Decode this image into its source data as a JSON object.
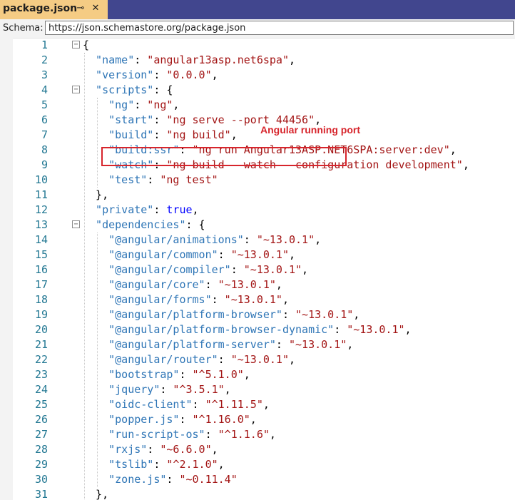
{
  "tab": {
    "title": "package.json",
    "pin_glyph": "⊸",
    "close_glyph": "✕"
  },
  "schema": {
    "label": "Schema:",
    "value": "https://json.schemastore.org/package.json"
  },
  "annotation": {
    "text": "Angular running port",
    "color": "#d7252c"
  },
  "colors": {
    "key": "#2e75b6",
    "string": "#a31515",
    "keyword": "#0000ff",
    "line_number": "#237893",
    "tab_active": "#f5cc84",
    "tab_bar": "#41468e"
  },
  "lines": [
    {
      "n": "1",
      "indent": 0,
      "fold": true,
      "tokens": [
        {
          "t": "p",
          "v": "{"
        }
      ]
    },
    {
      "n": "2",
      "indent": 1,
      "tokens": [
        {
          "t": "k",
          "v": "\"name\""
        },
        {
          "t": "p",
          "v": ": "
        },
        {
          "t": "s",
          "v": "\"angular13asp.net6spa\""
        },
        {
          "t": "p",
          "v": ","
        }
      ]
    },
    {
      "n": "3",
      "indent": 1,
      "tokens": [
        {
          "t": "k",
          "v": "\"version\""
        },
        {
          "t": "p",
          "v": ": "
        },
        {
          "t": "s",
          "v": "\"0.0.0\""
        },
        {
          "t": "p",
          "v": ","
        }
      ]
    },
    {
      "n": "4",
      "indent": 1,
      "fold": true,
      "tokens": [
        {
          "t": "k",
          "v": "\"scripts\""
        },
        {
          "t": "p",
          "v": ": {"
        }
      ]
    },
    {
      "n": "5",
      "indent": 2,
      "tokens": [
        {
          "t": "k",
          "v": "\"ng\""
        },
        {
          "t": "p",
          "v": ": "
        },
        {
          "t": "s",
          "v": "\"ng\""
        },
        {
          "t": "p",
          "v": ","
        }
      ]
    },
    {
      "n": "6",
      "indent": 2,
      "tokens": [
        {
          "t": "k",
          "v": "\"start\""
        },
        {
          "t": "p",
          "v": ": "
        },
        {
          "t": "s",
          "v": "\"ng serve --port 44456\""
        },
        {
          "t": "p",
          "v": ","
        }
      ]
    },
    {
      "n": "7",
      "indent": 2,
      "tokens": [
        {
          "t": "k",
          "v": "\"build\""
        },
        {
          "t": "p",
          "v": ": "
        },
        {
          "t": "s",
          "v": "\"ng build\""
        },
        {
          "t": "p",
          "v": ","
        }
      ]
    },
    {
      "n": "8",
      "indent": 2,
      "tokens": [
        {
          "t": "k",
          "v": "\"build:ssr\""
        },
        {
          "t": "p",
          "v": ": "
        },
        {
          "t": "s",
          "v": "\"ng run Angular13ASP.NET6SPA:server:dev\""
        },
        {
          "t": "p",
          "v": ","
        }
      ]
    },
    {
      "n": "9",
      "indent": 2,
      "tokens": [
        {
          "t": "k",
          "v": "\"watch\""
        },
        {
          "t": "p",
          "v": ": "
        },
        {
          "t": "s",
          "v": "\"ng build --watch --configuration development\""
        },
        {
          "t": "p",
          "v": ","
        }
      ]
    },
    {
      "n": "10",
      "indent": 2,
      "tokens": [
        {
          "t": "k",
          "v": "\"test\""
        },
        {
          "t": "p",
          "v": ": "
        },
        {
          "t": "s",
          "v": "\"ng test\""
        }
      ]
    },
    {
      "n": "11",
      "indent": 1,
      "tokens": [
        {
          "t": "p",
          "v": "},"
        }
      ]
    },
    {
      "n": "12",
      "indent": 1,
      "tokens": [
        {
          "t": "k",
          "v": "\"private\""
        },
        {
          "t": "p",
          "v": ": "
        },
        {
          "t": "b",
          "v": "true"
        },
        {
          "t": "p",
          "v": ","
        }
      ]
    },
    {
      "n": "13",
      "indent": 1,
      "fold": true,
      "tokens": [
        {
          "t": "k",
          "v": "\"dependencies\""
        },
        {
          "t": "p",
          "v": ": {"
        }
      ]
    },
    {
      "n": "14",
      "indent": 2,
      "tokens": [
        {
          "t": "k",
          "v": "\"@angular/animations\""
        },
        {
          "t": "p",
          "v": ": "
        },
        {
          "t": "s",
          "v": "\"~13.0.1\""
        },
        {
          "t": "p",
          "v": ","
        }
      ]
    },
    {
      "n": "15",
      "indent": 2,
      "tokens": [
        {
          "t": "k",
          "v": "\"@angular/common\""
        },
        {
          "t": "p",
          "v": ": "
        },
        {
          "t": "s",
          "v": "\"~13.0.1\""
        },
        {
          "t": "p",
          "v": ","
        }
      ]
    },
    {
      "n": "16",
      "indent": 2,
      "tokens": [
        {
          "t": "k",
          "v": "\"@angular/compiler\""
        },
        {
          "t": "p",
          "v": ": "
        },
        {
          "t": "s",
          "v": "\"~13.0.1\""
        },
        {
          "t": "p",
          "v": ","
        }
      ]
    },
    {
      "n": "17",
      "indent": 2,
      "tokens": [
        {
          "t": "k",
          "v": "\"@angular/core\""
        },
        {
          "t": "p",
          "v": ": "
        },
        {
          "t": "s",
          "v": "\"~13.0.1\""
        },
        {
          "t": "p",
          "v": ","
        }
      ]
    },
    {
      "n": "18",
      "indent": 2,
      "tokens": [
        {
          "t": "k",
          "v": "\"@angular/forms\""
        },
        {
          "t": "p",
          "v": ": "
        },
        {
          "t": "s",
          "v": "\"~13.0.1\""
        },
        {
          "t": "p",
          "v": ","
        }
      ]
    },
    {
      "n": "19",
      "indent": 2,
      "tokens": [
        {
          "t": "k",
          "v": "\"@angular/platform-browser\""
        },
        {
          "t": "p",
          "v": ": "
        },
        {
          "t": "s",
          "v": "\"~13.0.1\""
        },
        {
          "t": "p",
          "v": ","
        }
      ]
    },
    {
      "n": "20",
      "indent": 2,
      "tokens": [
        {
          "t": "k",
          "v": "\"@angular/platform-browser-dynamic\""
        },
        {
          "t": "p",
          "v": ": "
        },
        {
          "t": "s",
          "v": "\"~13.0.1\""
        },
        {
          "t": "p",
          "v": ","
        }
      ]
    },
    {
      "n": "21",
      "indent": 2,
      "tokens": [
        {
          "t": "k",
          "v": "\"@angular/platform-server\""
        },
        {
          "t": "p",
          "v": ": "
        },
        {
          "t": "s",
          "v": "\"~13.0.1\""
        },
        {
          "t": "p",
          "v": ","
        }
      ]
    },
    {
      "n": "22",
      "indent": 2,
      "tokens": [
        {
          "t": "k",
          "v": "\"@angular/router\""
        },
        {
          "t": "p",
          "v": ": "
        },
        {
          "t": "s",
          "v": "\"~13.0.1\""
        },
        {
          "t": "p",
          "v": ","
        }
      ]
    },
    {
      "n": "23",
      "indent": 2,
      "tokens": [
        {
          "t": "k",
          "v": "\"bootstrap\""
        },
        {
          "t": "p",
          "v": ": "
        },
        {
          "t": "s",
          "v": "\"^5.1.0\""
        },
        {
          "t": "p",
          "v": ","
        }
      ]
    },
    {
      "n": "24",
      "indent": 2,
      "tokens": [
        {
          "t": "k",
          "v": "\"jquery\""
        },
        {
          "t": "p",
          "v": ": "
        },
        {
          "t": "s",
          "v": "\"^3.5.1\""
        },
        {
          "t": "p",
          "v": ","
        }
      ]
    },
    {
      "n": "25",
      "indent": 2,
      "tokens": [
        {
          "t": "k",
          "v": "\"oidc-client\""
        },
        {
          "t": "p",
          "v": ": "
        },
        {
          "t": "s",
          "v": "\"^1.11.5\""
        },
        {
          "t": "p",
          "v": ","
        }
      ]
    },
    {
      "n": "26",
      "indent": 2,
      "tokens": [
        {
          "t": "k",
          "v": "\"popper.js\""
        },
        {
          "t": "p",
          "v": ": "
        },
        {
          "t": "s",
          "v": "\"^1.16.0\""
        },
        {
          "t": "p",
          "v": ","
        }
      ]
    },
    {
      "n": "27",
      "indent": 2,
      "tokens": [
        {
          "t": "k",
          "v": "\"run-script-os\""
        },
        {
          "t": "p",
          "v": ": "
        },
        {
          "t": "s",
          "v": "\"^1.1.6\""
        },
        {
          "t": "p",
          "v": ","
        }
      ]
    },
    {
      "n": "28",
      "indent": 2,
      "tokens": [
        {
          "t": "k",
          "v": "\"rxjs\""
        },
        {
          "t": "p",
          "v": ": "
        },
        {
          "t": "s",
          "v": "\"~6.6.0\""
        },
        {
          "t": "p",
          "v": ","
        }
      ]
    },
    {
      "n": "29",
      "indent": 2,
      "tokens": [
        {
          "t": "k",
          "v": "\"tslib\""
        },
        {
          "t": "p",
          "v": ": "
        },
        {
          "t": "s",
          "v": "\"^2.1.0\""
        },
        {
          "t": "p",
          "v": ","
        }
      ]
    },
    {
      "n": "30",
      "indent": 2,
      "tokens": [
        {
          "t": "k",
          "v": "\"zone.js\""
        },
        {
          "t": "p",
          "v": ": "
        },
        {
          "t": "s",
          "v": "\"~0.11.4\""
        }
      ]
    },
    {
      "n": "31",
      "indent": 1,
      "tokens": [
        {
          "t": "p",
          "v": "},"
        }
      ]
    }
  ]
}
